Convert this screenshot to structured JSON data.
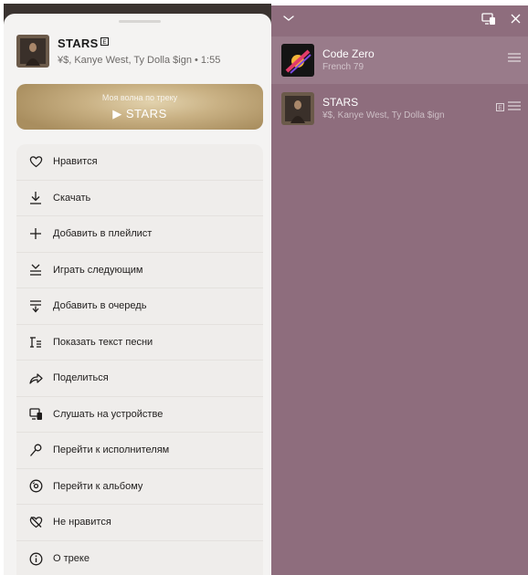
{
  "sheet": {
    "track": {
      "title": "STARS",
      "subtitle": "¥$, Kanye West, Ty Dolla $ign • 1:55",
      "explicit_badge": "E"
    },
    "wave": {
      "title": "Моя волна по треку",
      "action": "▶ STARS"
    },
    "menu": [
      {
        "label": "Нравится",
        "icon": "heart-icon"
      },
      {
        "label": "Скачать",
        "icon": "download-icon"
      },
      {
        "label": "Добавить в плейлист",
        "icon": "plus-icon"
      },
      {
        "label": "Играть следующим",
        "icon": "play-next-icon"
      },
      {
        "label": "Добавить в очередь",
        "icon": "add-to-queue-icon"
      },
      {
        "label": "Показать текст песни",
        "icon": "lyrics-icon"
      },
      {
        "label": "Поделиться",
        "icon": "share-icon"
      },
      {
        "label": "Слушать на устройстве",
        "icon": "device-icon"
      },
      {
        "label": "Перейти к исполнителям",
        "icon": "microphone-icon"
      },
      {
        "label": "Перейти к альбому",
        "icon": "album-icon"
      },
      {
        "label": "Не нравится",
        "icon": "dislike-icon"
      },
      {
        "label": "О треке",
        "icon": "info-icon"
      }
    ]
  },
  "queue": {
    "items": [
      {
        "title": "Code Zero",
        "subtitle": "French 79",
        "current": true
      },
      {
        "title": "STARS",
        "subtitle": "¥$, Kanye West, Ty Dolla $ign",
        "explicit_badge": "E",
        "current": false
      }
    ]
  },
  "colors": {
    "queue_bg": "#8e6d7d",
    "sheet_bg": "#f4f3f2",
    "wave_gold": "#c9b184"
  }
}
